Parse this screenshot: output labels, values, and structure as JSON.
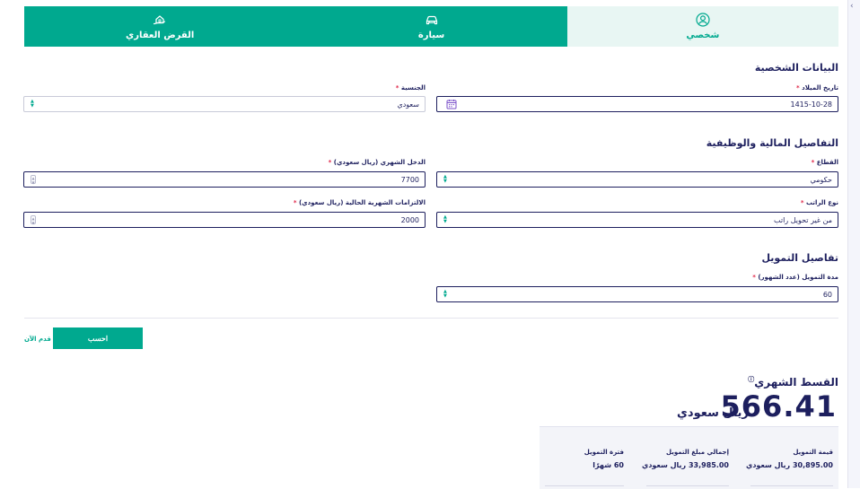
{
  "tabs": [
    {
      "label": "شخصي",
      "icon": "user-icon",
      "active": true
    },
    {
      "label": "سيارة",
      "icon": "car-icon",
      "active": false
    },
    {
      "label": "القرض العقاري",
      "icon": "house-hand-icon",
      "active": false
    }
  ],
  "sections": {
    "personal": "البيانات الشخصية",
    "financial": "التفاصيل المالية والوظيفية",
    "financing": "تفاصيل التمويل"
  },
  "fields": {
    "birth_date": {
      "label": "تاريخ الميلاد",
      "value": "1415-10-28"
    },
    "nationality": {
      "label": "الجنسية",
      "value": "سعودي"
    },
    "sector": {
      "label": "القطاع",
      "value": "حكومي"
    },
    "monthly_income": {
      "label": "الدخل الشهري (ريال سعودي)",
      "value": "7700"
    },
    "salary_type": {
      "label": "نوع الراتب",
      "value": "من غير تحويل راتب"
    },
    "monthly_obligations": {
      "label": "الالتزامات الشهرية الحالية (ريال سعودي)",
      "value": "2000"
    },
    "financing_period": {
      "label": "مدة التمويل (عدد الشهور)",
      "value": "60"
    }
  },
  "required_mark": "*",
  "actions": {
    "calculate": "احسب",
    "apply_now": "قدم الآن"
  },
  "result": {
    "title": "القسط الشهري",
    "info_mark": "ⓘ",
    "amount": "566.41",
    "currency": "ريال سعودي",
    "summary": [
      {
        "label": "قيمة التمويل",
        "value": "30,895.00 ريال سعودي"
      },
      {
        "label": "إجمالي مبلغ التمويل",
        "value": "33,985.00 ريال سعودي"
      },
      {
        "label": "فترة التمويل",
        "value": "60 شهرًا"
      }
    ]
  },
  "colors": {
    "primary": "#00a98f",
    "navy": "#1d1f5e",
    "active_tab_bg": "#e8f6f3",
    "required": "#e0284a"
  }
}
